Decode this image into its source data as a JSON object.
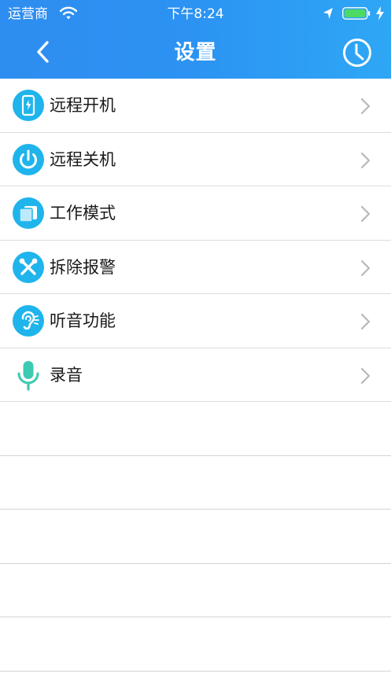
{
  "status_bar": {
    "carrier": "运营商",
    "time": "下午8:24"
  },
  "nav": {
    "title": "设置"
  },
  "colors": {
    "header_start": "#2e8df0",
    "header_end": "#2ea7f5",
    "icon_blue": "#1fb4ec",
    "mic_green": "#3ec9b3",
    "battery_green": "#4cd964"
  },
  "settings": [
    {
      "label": "远程开机",
      "icon": "phone-power-icon"
    },
    {
      "label": "远程关机",
      "icon": "power-icon"
    },
    {
      "label": "工作模式",
      "icon": "layers-icon"
    },
    {
      "label": "拆除报警",
      "icon": "tools-icon"
    },
    {
      "label": "听音功能",
      "icon": "ear-icon"
    },
    {
      "label": "录音",
      "icon": "microphone-icon"
    }
  ]
}
